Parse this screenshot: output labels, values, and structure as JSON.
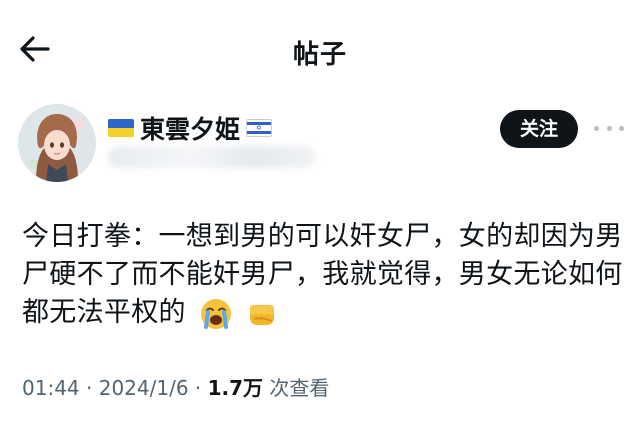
{
  "header": {
    "title": "帖子",
    "back_icon": "arrow-left-icon"
  },
  "author": {
    "display_name": "東雲夕姫",
    "prefix_flag": "ukraine-flag-icon",
    "suffix_flag": "israel-flag-icon",
    "follow_label": "关注",
    "more_icon": "more-horizontal-icon"
  },
  "post": {
    "text": "今日打拳：一想到男的可以奸女尸，女的却因为男尸硬不了而不能奸男尸，我就觉得，男女无论如何都无法平权的",
    "emojis": [
      "crying-face-icon",
      "fist-icon"
    ]
  },
  "meta": {
    "time": "01:44",
    "sep1": " · ",
    "date": "2024/1/6",
    "sep2": " · ",
    "views_count": "1.7万",
    "views_label": " 次查看"
  }
}
